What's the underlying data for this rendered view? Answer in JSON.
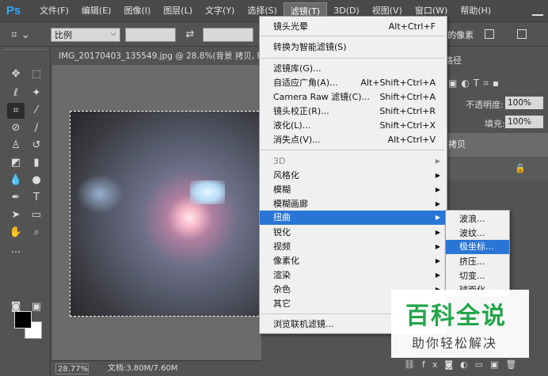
{
  "app": {
    "logo": "Ps"
  },
  "menubar": {
    "items": [
      "文件(F)",
      "编辑(E)",
      "图像(I)",
      "图层(L)",
      "文字(Y)",
      "选择(S)",
      "滤镜(T)",
      "3D(D)",
      "视图(V)",
      "窗口(W)",
      "帮助(H)"
    ],
    "active_index": 6
  },
  "options_bar": {
    "tool_icon": "crop-icon",
    "ratio_select": "比例",
    "right_text": "的像素"
  },
  "document": {
    "tab_title": "IMG_20170403_135549.jpg @ 28.8%(背景 拷贝, RGB",
    "zoom": "28.77%",
    "doc_info": "文档:3.80M/7.60M"
  },
  "filter_menu": {
    "items": [
      {
        "label": "镜头光晕",
        "shortcut": "Alt+Ctrl+F"
      },
      {
        "label": "转换为智能滤镜(S)",
        "shortcut": ""
      },
      {
        "label": "滤镜库(G)...",
        "shortcut": ""
      },
      {
        "label": "自适应广角(A)...",
        "shortcut": "Alt+Shift+Ctrl+A"
      },
      {
        "label": "Camera Raw 滤镜(C)...",
        "shortcut": "Shift+Ctrl+A"
      },
      {
        "label": "镜头校正(R)...",
        "shortcut": "Shift+Ctrl+R"
      },
      {
        "label": "液化(L)...",
        "shortcut": "Shift+Ctrl+X"
      },
      {
        "label": "消失点(V)...",
        "shortcut": "Alt+Ctrl+V"
      },
      {
        "label": "3D",
        "shortcut": "",
        "disabled": true
      },
      {
        "label": "风格化",
        "shortcut": ""
      },
      {
        "label": "模糊",
        "shortcut": ""
      },
      {
        "label": "模糊画廊",
        "shortcut": ""
      },
      {
        "label": "扭曲",
        "shortcut": "",
        "highlighted": true
      },
      {
        "label": "锐化",
        "shortcut": ""
      },
      {
        "label": "视频",
        "shortcut": ""
      },
      {
        "label": "像素化",
        "shortcut": ""
      },
      {
        "label": "渲染",
        "shortcut": ""
      },
      {
        "label": "杂色",
        "shortcut": ""
      },
      {
        "label": "其它",
        "shortcut": ""
      },
      {
        "label": "浏览联机滤镜...",
        "shortcut": ""
      }
    ]
  },
  "distort_submenu": {
    "items": [
      "波浪...",
      "波纹...",
      "极坐标...",
      "挤压...",
      "切变...",
      "球面化..."
    ],
    "highlighted_index": 2
  },
  "layers_panel": {
    "tab_label": "路径",
    "opacity_label": "不透明度:",
    "opacity_value": "100%",
    "fill_label": "填充:",
    "fill_value": "100%",
    "layer_name": "拷贝"
  },
  "watermark": {
    "title": "百科全说",
    "subtitle": "助你轻松解决"
  }
}
